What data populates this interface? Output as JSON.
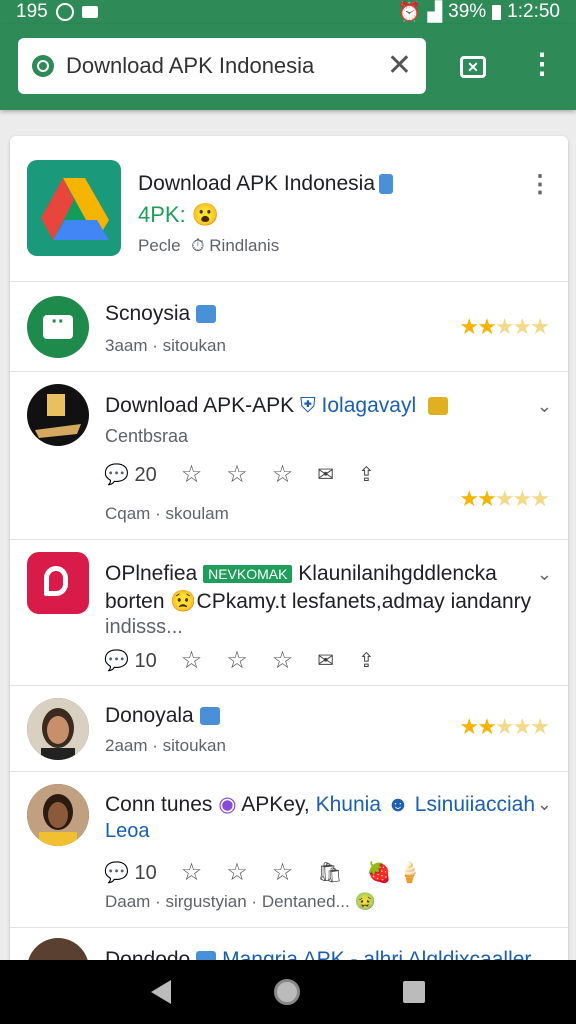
{
  "status": {
    "left_number": "195",
    "battery": "39%",
    "time": "1:2:50"
  },
  "search": {
    "query": "Download APK Indonesia"
  },
  "header_card": {
    "title": "Download APK Indonesia",
    "subtitle": "4PK:",
    "meta_left": "Pecle",
    "meta_right": "Rindlanis"
  },
  "items": [
    {
      "name": "Scnoysia",
      "sub": "3aam · sitoukan",
      "rating": 2.5
    },
    {
      "name": "Download APK-APK",
      "name_extra": "Iolagavayl",
      "line2": "Centbsraa",
      "comments": "20",
      "sub": "Cqam · skoulam",
      "rating": 2.5
    },
    {
      "name": "OPlnefiea",
      "tag": "NEVKOMAK",
      "name_extra": "Klaunilanihgddlencka",
      "line2": "borten",
      "line2_extra": "CPkamy.t lesfanets,admay iandanry",
      "line3": "indisss...",
      "comments": "10"
    },
    {
      "name": "Donoyala",
      "sub": "2aam · sitoukan",
      "rating": 2.5
    },
    {
      "name": "Conn tunes",
      "name_mid": "APKey,",
      "name_extra": "Khunia",
      "name_extra2": "Lsinuiiacciah",
      "line2": "Leoa",
      "comments": "10",
      "sub": "Daam · sirgustyian · Dentaned..."
    },
    {
      "name": "Dondodo",
      "name_extra": "Mangria APK - alhri Alqldixcaaller"
    }
  ],
  "colors": {
    "brand": "#2e8b57",
    "star": "#f4b400",
    "link": "#1a5fb4"
  }
}
